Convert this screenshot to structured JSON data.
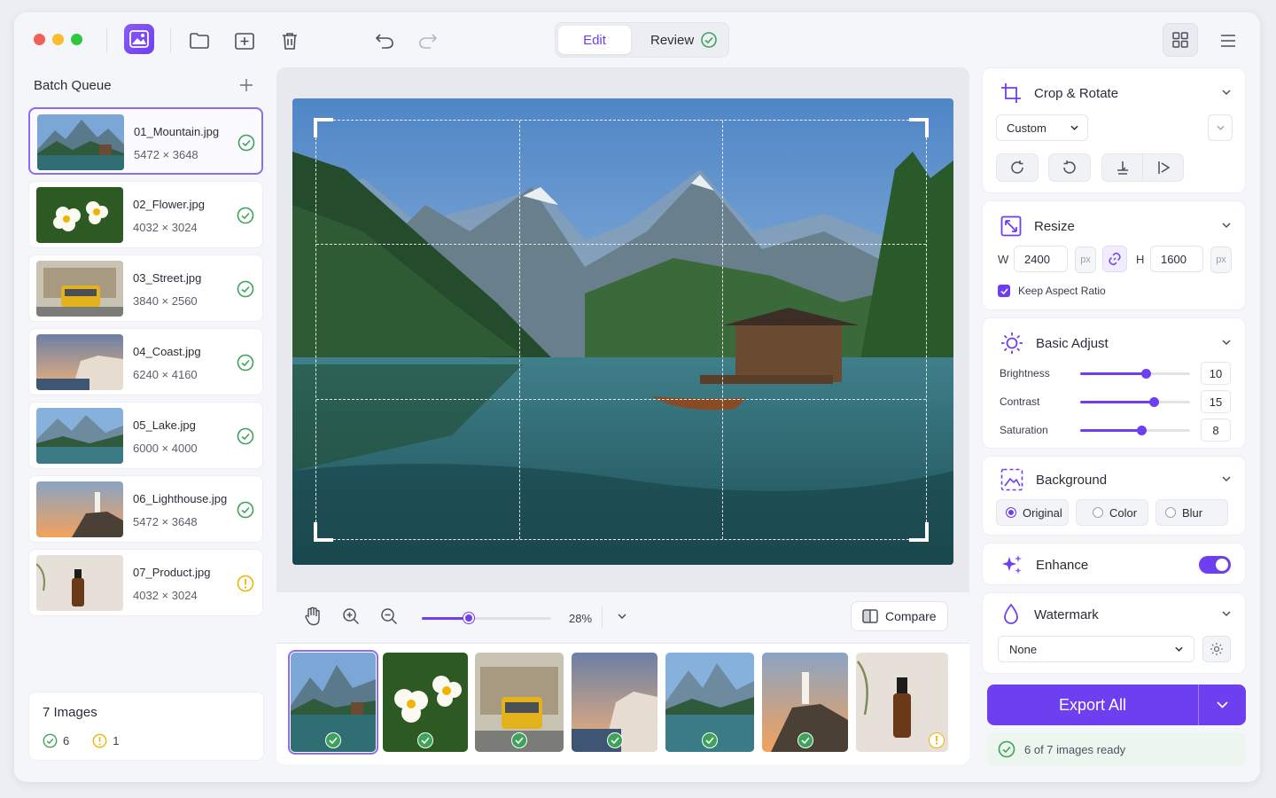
{
  "toolbar": {
    "mode_edit": "Edit",
    "mode_review": "Review",
    "icons": [
      "image-app-icon",
      "folder-icon",
      "add-image-icon",
      "trash-icon",
      "undo-icon",
      "redo-icon",
      "grid-view-icon",
      "menu-icon"
    ]
  },
  "queue": {
    "title": "Batch Queue",
    "items": [
      {
        "name": "01_Mountain.jpg",
        "dims": "5472 × 3648",
        "status": "ok"
      },
      {
        "name": "02_Flower.jpg",
        "dims": "4032 × 3024",
        "status": "ok"
      },
      {
        "name": "03_Street.jpg",
        "dims": "3840 × 2560",
        "status": "ok"
      },
      {
        "name": "04_Coast.jpg",
        "dims": "6240 × 4160",
        "status": "ok"
      },
      {
        "name": "05_Lake.jpg",
        "dims": "6000 × 4000",
        "status": "ok"
      },
      {
        "name": "06_Lighthouse.jpg",
        "dims": "5472 × 3648",
        "status": "ok"
      },
      {
        "name": "07_Product.jpg",
        "dims": "4032 × 3024",
        "status": "warn"
      }
    ],
    "footer": {
      "title": "7 Images",
      "ok_count": "6",
      "warn_count": "1"
    }
  },
  "viewer": {
    "zoom": "28%",
    "zoom_fraction": 0.36,
    "compare_label": "Compare"
  },
  "panel": {
    "crop": {
      "title": "Crop & Rotate",
      "preset": "Custom"
    },
    "resize": {
      "title": "Resize",
      "w_label": "W",
      "w_value": "2400",
      "h_label": "H",
      "h_value": "1600",
      "unit": "px",
      "keep_label": "Keep Aspect Ratio"
    },
    "adjust": {
      "title": "Basic Adjust",
      "rows": [
        {
          "label": "Brightness",
          "value": "10",
          "level": 0.6
        },
        {
          "label": "Contrast",
          "value": "15",
          "level": 0.67
        },
        {
          "label": "Saturation",
          "value": "8",
          "level": 0.56
        }
      ]
    },
    "background": {
      "title": "Background",
      "options": [
        "Original",
        "Color",
        "Blur"
      ],
      "selected": "Original"
    },
    "enhance": {
      "title": "Enhance",
      "enabled": true
    },
    "watermark": {
      "title": "Watermark",
      "value": "None"
    },
    "export_label": "Export All",
    "ready_text": "6 of 7 images ready"
  },
  "colors": {
    "accent": "#6d3ff0",
    "ok": "#3da35a",
    "warn": "#f0b400"
  }
}
